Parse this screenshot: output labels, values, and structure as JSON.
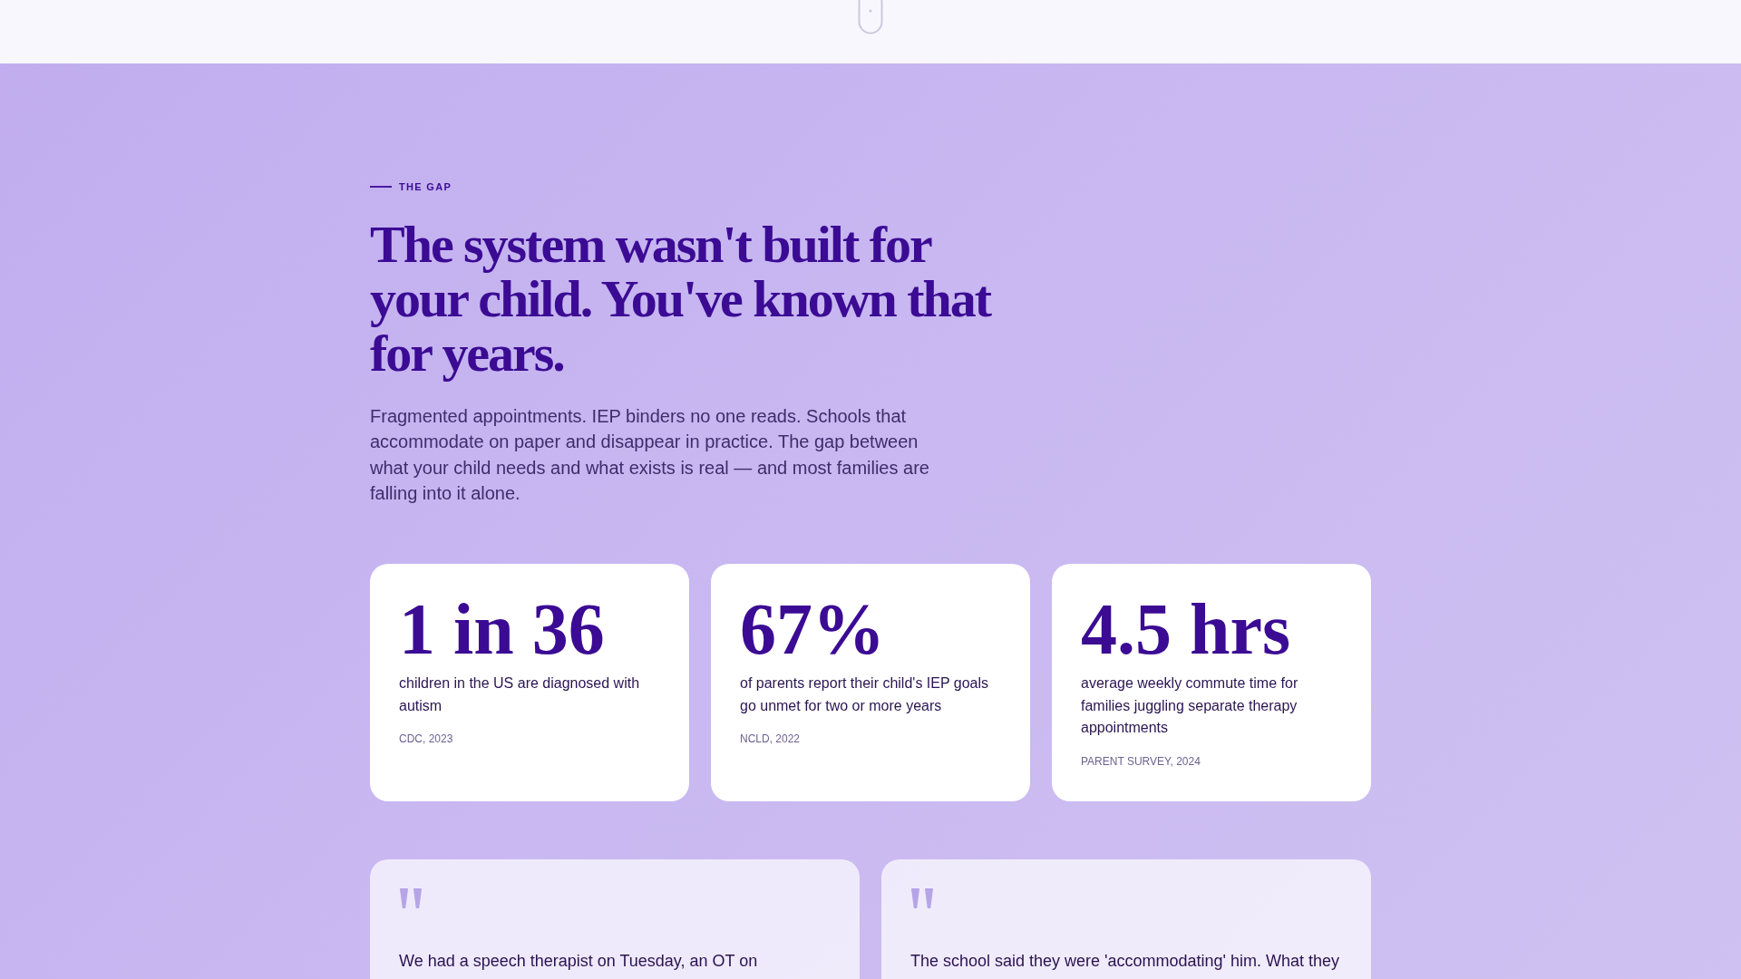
{
  "section": {
    "eyebrow": "THE GAP",
    "heading": "The system wasn't built for your child. You've known that for years.",
    "intro": "Fragmented appointments. IEP binders no one reads. Schools that accommodate on paper and disappear in practice. The gap between what your child needs and what exists is real — and most families are falling into it alone."
  },
  "stats": [
    {
      "value": "1 in 36",
      "description": "children in the US are diagnosed with autism",
      "source": "CDC, 2023"
    },
    {
      "value": "67%",
      "description": "of parents report their child's IEP goals go unmet for two or more years",
      "source": "NCLD, 2022"
    },
    {
      "value": "4.5 hrs",
      "description": "average weekly commute time for families juggling separate therapy appointments",
      "source": "PARENT SURVEY, 2024"
    }
  ],
  "testimonials": [
    {
      "quote": "We had a speech therapist on Tuesday, an OT on"
    },
    {
      "quote": "The school said they were 'accommodating' him. What they"
    }
  ]
}
